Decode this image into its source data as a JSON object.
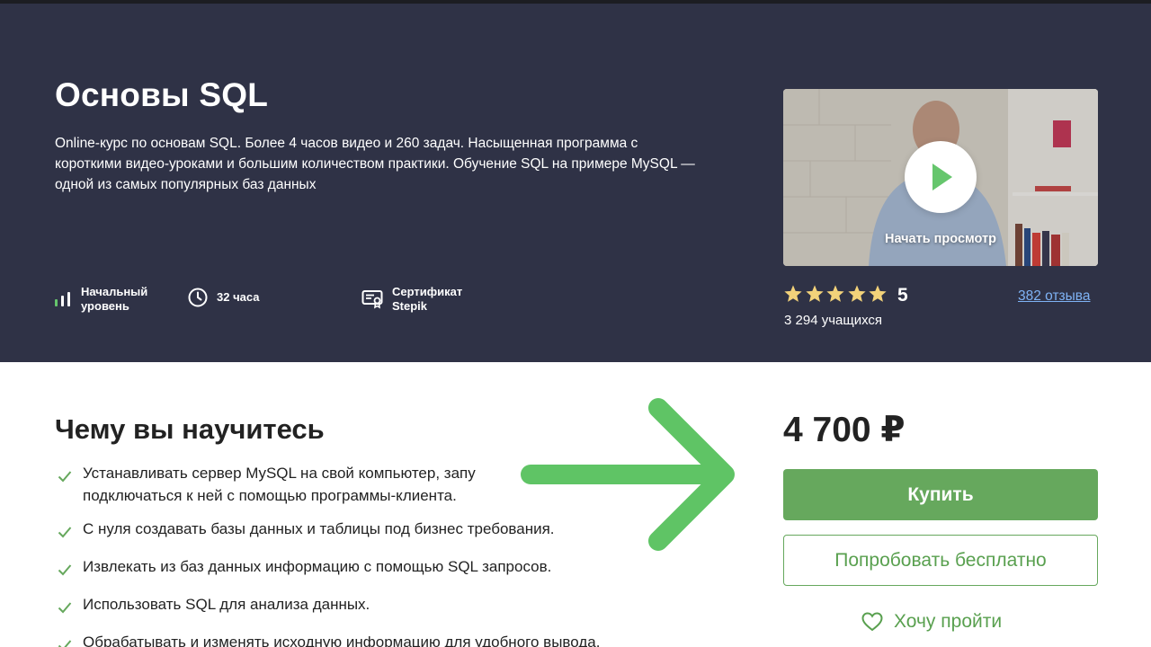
{
  "course": {
    "title": "Основы SQL",
    "description": "Online-курс по основам SQL. Более 4 часов видео и 260 задач. Насыщенная программа с короткими видео-уроками и большим количеством практики. Обучение SQL на примере MySQL — одной из самых популярных баз данных"
  },
  "meta": {
    "level_line1": "Начальный",
    "level_line2": "уровень",
    "hours": "32 часа",
    "cert_line1": "Сертификат",
    "cert_line2": "Stepik"
  },
  "video": {
    "label": "Начать просмотр"
  },
  "rating": {
    "stars": 5,
    "value": "5",
    "reviews": "382 отзыва",
    "students": "3 294 учащихся",
    "star_color": "#f2d27a"
  },
  "learn": {
    "title": "Чему вы научитесь",
    "items": [
      "Устанавливать сервер MySQL на свой компьютер, запу подключаться к ней с помощью программы-клиента.",
      "С нуля создавать базы данных и таблицы под бизнес требования.",
      "Извлекать из баз данных информацию с помощью SQL запросов.",
      "Использовать SQL для анализа данных.",
      "Обрабатывать и изменять исходную информацию для удобного вывода."
    ]
  },
  "purchase": {
    "price": "4 700 ₽",
    "buy_label": "Купить",
    "try_label": "Попробовать бесплатно",
    "wish_label": "Хочу пройти"
  },
  "colors": {
    "hero_bg": "#2f3246",
    "accent_green": "#66a85d",
    "annotation_arrow": "#5fc465",
    "link_blue": "#7fb3f5"
  }
}
